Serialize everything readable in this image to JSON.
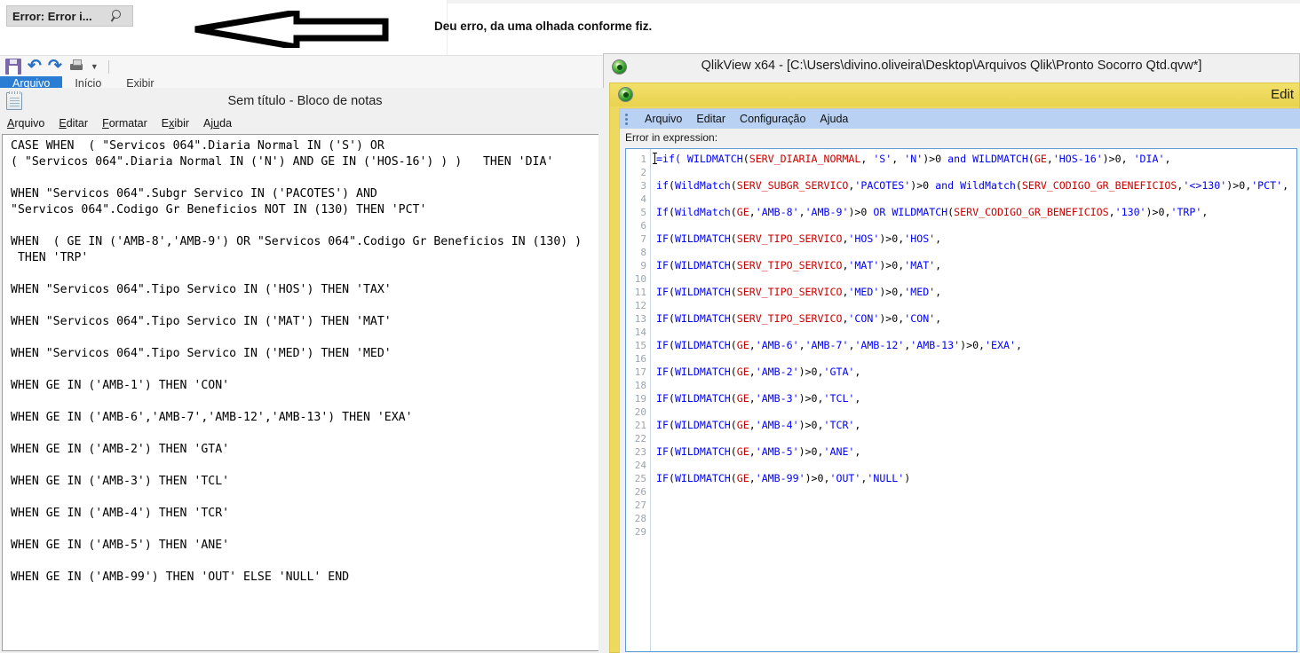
{
  "annotation": {
    "arrow_icon": "left-arrow-annotation",
    "text": "Deu erro, da uma olhada conforme fiz."
  },
  "error_field": {
    "value": "Error: Error i...",
    "icon": "search-icon"
  },
  "background_app": {
    "quick_access": [
      {
        "icon": "save-icon",
        "label": "Salvar"
      },
      {
        "icon": "undo-icon",
        "label": "Desfazer"
      },
      {
        "icon": "redo-icon",
        "label": "Refazer"
      },
      {
        "icon": "print-icon",
        "label": "Imprimir"
      },
      {
        "icon": "chevron-down-icon",
        "label": "Personalizar"
      }
    ],
    "tabs": [
      {
        "label": "Arquivo",
        "active": true
      },
      {
        "label": "Início",
        "active": false
      },
      {
        "label": "Exibir",
        "active": false
      }
    ]
  },
  "notepad": {
    "icon": "notepad-icon",
    "title": "Sem título - Bloco de notas",
    "title_truncated": "Sem t",
    "menu": [
      "Arquivo",
      "Editar",
      "Formatar",
      "Exibir",
      "Ajuda"
    ],
    "content_lines": [
      "CASE WHEN  ( \"Servicos 064\".Diaria Normal IN ('S') OR",
      "( \"Servicos 064\".Diaria Normal IN ('N') AND GE IN ('HOS-16') ) )   THEN 'DIA'",
      "",
      "WHEN \"Servicos 064\".Subgr Servico IN ('PACOTES') AND",
      "\"Servicos 064\".Codigo Gr Beneficios NOT IN (130) THEN 'PCT'",
      "",
      "WHEN  ( GE IN ('AMB-8','AMB-9') OR \"Servicos 064\".Codigo Gr Beneficios IN (130) )",
      " THEN 'TRP'",
      "",
      "WHEN \"Servicos 064\".Tipo Servico IN ('HOS') THEN 'TAX'",
      "",
      "WHEN \"Servicos 064\".Tipo Servico IN ('MAT') THEN 'MAT'",
      "",
      "WHEN \"Servicos 064\".Tipo Servico IN ('MED') THEN 'MED'",
      "",
      "WHEN GE IN ('AMB-1') THEN 'CON'",
      "",
      "WHEN GE IN ('AMB-6','AMB-7','AMB-12','AMB-13') THEN 'EXA'",
      "",
      "WHEN GE IN ('AMB-2') THEN 'GTA'",
      "",
      "WHEN GE IN ('AMB-3') THEN 'TCL'",
      "",
      "WHEN GE IN ('AMB-4') THEN 'TCR'",
      "",
      "WHEN GE IN ('AMB-5') THEN 'ANE'",
      "",
      "WHEN GE IN ('AMB-99') THEN 'OUT' ELSE 'NULL' END"
    ]
  },
  "qlikview_main": {
    "logo_icon": "qlikview-logo-icon",
    "title": "QlikView x64 - [C:\\Users\\divino.oliveira\\Desktop\\Arquivos Qlik\\Pronto Socorro Qtd.qvw*]"
  },
  "qlikview_dialog": {
    "logo_icon": "qlikview-logo-icon",
    "title": "Edit",
    "menu": [
      "Arquivo",
      "Editar",
      "Configuração",
      "Ajuda"
    ],
    "error_label": "Error in expression:",
    "gutter_line_count": 29,
    "expression_lines": [
      {
        "n": 1,
        "tokens": [
          {
            "t": "=if( ",
            "c": "blue"
          },
          {
            "t": "WILDMATCH",
            "c": "blue"
          },
          {
            "t": "(",
            "c": "blk"
          },
          {
            "t": "SERV_DIARIA_NORMAL",
            "c": "red"
          },
          {
            "t": ", ",
            "c": "blk"
          },
          {
            "t": "'S'",
            "c": "blue"
          },
          {
            "t": ", ",
            "c": "blk"
          },
          {
            "t": "'N'",
            "c": "blue"
          },
          {
            "t": ")>0 ",
            "c": "blk"
          },
          {
            "t": "and",
            "c": "blue"
          },
          {
            "t": " ",
            "c": "blk"
          },
          {
            "t": "WILDMATCH",
            "c": "blue"
          },
          {
            "t": "(",
            "c": "blk"
          },
          {
            "t": "GE",
            "c": "red"
          },
          {
            "t": ",",
            "c": "blk"
          },
          {
            "t": "'HOS-16'",
            "c": "blue"
          },
          {
            "t": ")>0, ",
            "c": "blk"
          },
          {
            "t": "'DIA'",
            "c": "blue"
          },
          {
            "t": ",",
            "c": "blk"
          }
        ]
      },
      {
        "n": 3,
        "tokens": [
          {
            "t": "if",
            "c": "blue"
          },
          {
            "t": "(",
            "c": "blk"
          },
          {
            "t": "WildMatch",
            "c": "blue"
          },
          {
            "t": "(",
            "c": "blk"
          },
          {
            "t": "SERV_SUBGR_SERVICO",
            "c": "red"
          },
          {
            "t": ",",
            "c": "blk"
          },
          {
            "t": "'PACOTES'",
            "c": "blue"
          },
          {
            "t": ")>0 ",
            "c": "blk"
          },
          {
            "t": "and",
            "c": "blue"
          },
          {
            "t": " ",
            "c": "blk"
          },
          {
            "t": "WildMatch",
            "c": "blue"
          },
          {
            "t": "(",
            "c": "blk"
          },
          {
            "t": "SERV_CODIGO_GR_BENEFICIOS",
            "c": "red"
          },
          {
            "t": ",",
            "c": "blk"
          },
          {
            "t": "'<>130'",
            "c": "blue"
          },
          {
            "t": ")>0,",
            "c": "blk"
          },
          {
            "t": "'PCT'",
            "c": "blue"
          },
          {
            "t": ",",
            "c": "blk"
          }
        ]
      },
      {
        "n": 5,
        "tokens": [
          {
            "t": "If",
            "c": "blue"
          },
          {
            "t": "(",
            "c": "blk"
          },
          {
            "t": "WildMatch",
            "c": "blue"
          },
          {
            "t": "(",
            "c": "blk"
          },
          {
            "t": "GE",
            "c": "red"
          },
          {
            "t": ",",
            "c": "blk"
          },
          {
            "t": "'AMB-8'",
            "c": "blue"
          },
          {
            "t": ",",
            "c": "blk"
          },
          {
            "t": "'AMB-9'",
            "c": "blue"
          },
          {
            "t": ")>0 ",
            "c": "blk"
          },
          {
            "t": "OR",
            "c": "blue"
          },
          {
            "t": " ",
            "c": "blk"
          },
          {
            "t": "WILDMATCH",
            "c": "blue"
          },
          {
            "t": "(",
            "c": "blk"
          },
          {
            "t": "SERV_CODIGO_GR_BENEFICIOS",
            "c": "red"
          },
          {
            "t": ",",
            "c": "blk"
          },
          {
            "t": "'130'",
            "c": "blue"
          },
          {
            "t": ")>0,",
            "c": "blk"
          },
          {
            "t": "'TRP'",
            "c": "blue"
          },
          {
            "t": ",",
            "c": "blk"
          }
        ]
      },
      {
        "n": 7,
        "tokens": [
          {
            "t": "IF",
            "c": "blue"
          },
          {
            "t": "(",
            "c": "blk"
          },
          {
            "t": "WILDMATCH",
            "c": "blue"
          },
          {
            "t": "(",
            "c": "blk"
          },
          {
            "t": "SERV_TIPO_SERVICO",
            "c": "red"
          },
          {
            "t": ",",
            "c": "blk"
          },
          {
            "t": "'HOS'",
            "c": "blue"
          },
          {
            "t": ")>0,",
            "c": "blk"
          },
          {
            "t": "'HOS'",
            "c": "blue"
          },
          {
            "t": ",",
            "c": "blk"
          }
        ]
      },
      {
        "n": 9,
        "tokens": [
          {
            "t": "IF",
            "c": "blue"
          },
          {
            "t": "(",
            "c": "blk"
          },
          {
            "t": "WILDMATCH",
            "c": "blue"
          },
          {
            "t": "(",
            "c": "blk"
          },
          {
            "t": "SERV_TIPO_SERVICO",
            "c": "red"
          },
          {
            "t": ",",
            "c": "blk"
          },
          {
            "t": "'MAT'",
            "c": "blue"
          },
          {
            "t": ")>0,",
            "c": "blk"
          },
          {
            "t": "'MAT'",
            "c": "blue"
          },
          {
            "t": ",",
            "c": "blk"
          }
        ]
      },
      {
        "n": 11,
        "tokens": [
          {
            "t": "IF",
            "c": "blue"
          },
          {
            "t": "(",
            "c": "blk"
          },
          {
            "t": "WILDMATCH",
            "c": "blue"
          },
          {
            "t": "(",
            "c": "blk"
          },
          {
            "t": "SERV_TIPO_SERVICO",
            "c": "red"
          },
          {
            "t": ",",
            "c": "blk"
          },
          {
            "t": "'MED'",
            "c": "blue"
          },
          {
            "t": ")>0,",
            "c": "blk"
          },
          {
            "t": "'MED'",
            "c": "blue"
          },
          {
            "t": ",",
            "c": "blk"
          }
        ]
      },
      {
        "n": 13,
        "tokens": [
          {
            "t": "IF",
            "c": "blue"
          },
          {
            "t": "(",
            "c": "blk"
          },
          {
            "t": "WILDMATCH",
            "c": "blue"
          },
          {
            "t": "(",
            "c": "blk"
          },
          {
            "t": "SERV_TIPO_SERVICO",
            "c": "red"
          },
          {
            "t": ",",
            "c": "blk"
          },
          {
            "t": "'CON'",
            "c": "blue"
          },
          {
            "t": ")>0,",
            "c": "blk"
          },
          {
            "t": "'CON'",
            "c": "blue"
          },
          {
            "t": ",",
            "c": "blk"
          }
        ]
      },
      {
        "n": 15,
        "tokens": [
          {
            "t": "IF",
            "c": "blue"
          },
          {
            "t": "(",
            "c": "blk"
          },
          {
            "t": "WILDMATCH",
            "c": "blue"
          },
          {
            "t": "(",
            "c": "blk"
          },
          {
            "t": "GE",
            "c": "red"
          },
          {
            "t": ",",
            "c": "blk"
          },
          {
            "t": "'AMB-6'",
            "c": "blue"
          },
          {
            "t": ",",
            "c": "blk"
          },
          {
            "t": "'AMB-7'",
            "c": "blue"
          },
          {
            "t": ",",
            "c": "blk"
          },
          {
            "t": "'AMB-12'",
            "c": "blue"
          },
          {
            "t": ",",
            "c": "blk"
          },
          {
            "t": "'AMB-13'",
            "c": "blue"
          },
          {
            "t": ")>0,",
            "c": "blk"
          },
          {
            "t": "'EXA'",
            "c": "blue"
          },
          {
            "t": ",",
            "c": "blk"
          }
        ]
      },
      {
        "n": 17,
        "tokens": [
          {
            "t": "IF",
            "c": "blue"
          },
          {
            "t": "(",
            "c": "blk"
          },
          {
            "t": "WILDMATCH",
            "c": "blue"
          },
          {
            "t": "(",
            "c": "blk"
          },
          {
            "t": "GE",
            "c": "red"
          },
          {
            "t": ",",
            "c": "blk"
          },
          {
            "t": "'AMB-2'",
            "c": "blue"
          },
          {
            "t": ")>0,",
            "c": "blk"
          },
          {
            "t": "'GTA'",
            "c": "blue"
          },
          {
            "t": ",",
            "c": "blk"
          }
        ]
      },
      {
        "n": 19,
        "tokens": [
          {
            "t": "IF",
            "c": "blue"
          },
          {
            "t": "(",
            "c": "blk"
          },
          {
            "t": "WILDMATCH",
            "c": "blue"
          },
          {
            "t": "(",
            "c": "blk"
          },
          {
            "t": "GE",
            "c": "red"
          },
          {
            "t": ",",
            "c": "blk"
          },
          {
            "t": "'AMB-3'",
            "c": "blue"
          },
          {
            "t": ")>0,",
            "c": "blk"
          },
          {
            "t": "'TCL'",
            "c": "blue"
          },
          {
            "t": ",",
            "c": "blk"
          }
        ]
      },
      {
        "n": 21,
        "tokens": [
          {
            "t": "IF",
            "c": "blue"
          },
          {
            "t": "(",
            "c": "blk"
          },
          {
            "t": "WILDMATCH",
            "c": "blue"
          },
          {
            "t": "(",
            "c": "blk"
          },
          {
            "t": "GE",
            "c": "red"
          },
          {
            "t": ",",
            "c": "blk"
          },
          {
            "t": "'AMB-4'",
            "c": "blue"
          },
          {
            "t": ")>0,",
            "c": "blk"
          },
          {
            "t": "'TCR'",
            "c": "blue"
          },
          {
            "t": ",",
            "c": "blk"
          }
        ]
      },
      {
        "n": 23,
        "tokens": [
          {
            "t": "IF",
            "c": "blue"
          },
          {
            "t": "(",
            "c": "blk"
          },
          {
            "t": "WILDMATCH",
            "c": "blue"
          },
          {
            "t": "(",
            "c": "blk"
          },
          {
            "t": "GE",
            "c": "red"
          },
          {
            "t": ",",
            "c": "blk"
          },
          {
            "t": "'AMB-5'",
            "c": "blue"
          },
          {
            "t": ")>0,",
            "c": "blk"
          },
          {
            "t": "'ANE'",
            "c": "blue"
          },
          {
            "t": ",",
            "c": "blk"
          }
        ]
      },
      {
        "n": 25,
        "tokens": [
          {
            "t": "IF",
            "c": "blue"
          },
          {
            "t": "(",
            "c": "blk"
          },
          {
            "t": "WILDMATCH",
            "c": "blue"
          },
          {
            "t": "(",
            "c": "blk"
          },
          {
            "t": "GE",
            "c": "red"
          },
          {
            "t": ",",
            "c": "blk"
          },
          {
            "t": "'AMB-99'",
            "c": "blue"
          },
          {
            "t": ")>0,",
            "c": "blk"
          },
          {
            "t": "'OUT'",
            "c": "blue"
          },
          {
            "t": ",",
            "c": "blk"
          },
          {
            "t": "'NULL'",
            "c": "blue"
          },
          {
            "t": ")",
            "c": "blk"
          }
        ]
      }
    ]
  },
  "colors": {
    "dialog_title_bar": "#ecd95e",
    "dialog_menu_bar": "#b9d1f2",
    "editor_border": "#5b9bd5",
    "keyword_blue": "#0000ff",
    "field_red": "#cc0000",
    "ribbon_active_tab": "#2b7cd3"
  }
}
